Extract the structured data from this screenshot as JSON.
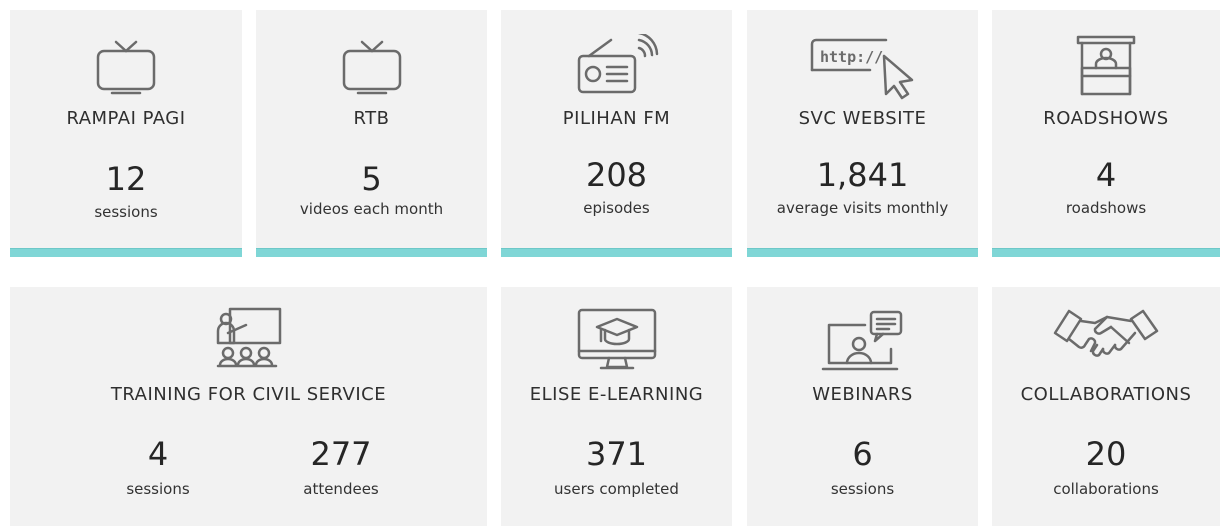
{
  "cards": [
    {
      "title": "RAMPAI PAGI",
      "value": "12",
      "unit": "sessions",
      "icon": "tv-icon"
    },
    {
      "title": "RTB",
      "value": "5",
      "unit": "videos each month",
      "icon": "tv-icon"
    },
    {
      "title": "PILIHAN FM",
      "value": "208",
      "unit": "episodes",
      "icon": "radio-icon"
    },
    {
      "title": "SVC WEBSITE",
      "value": "1,841",
      "unit": "average visits monthly",
      "icon": "browser-cursor-icon",
      "icon_text": "http://"
    },
    {
      "title": "ROADSHOWS",
      "value": "4",
      "unit": "roadshows",
      "icon": "booth-icon"
    },
    {
      "title": "TRAINING FOR CIVIL SERVICE",
      "stats": [
        {
          "value": "4",
          "unit": "sessions"
        },
        {
          "value": "277",
          "unit": "attendees"
        }
      ],
      "icon": "presentation-audience-icon"
    },
    {
      "title": "ELISE E-LEARNING",
      "value": "371",
      "unit": "users completed",
      "icon": "graduation-monitor-icon"
    },
    {
      "title": "WEBINARS",
      "value": "6",
      "unit": "sessions",
      "icon": "video-call-chat-icon"
    },
    {
      "title": "COLLABORATIONS",
      "value": "20",
      "unit": "collaborations",
      "icon": "handshake-icon"
    }
  ],
  "colors": {
    "card_bg": "#f2f2f2",
    "accent_bar": "#7fd6d6",
    "icon_stroke": "#6b6b6b"
  }
}
